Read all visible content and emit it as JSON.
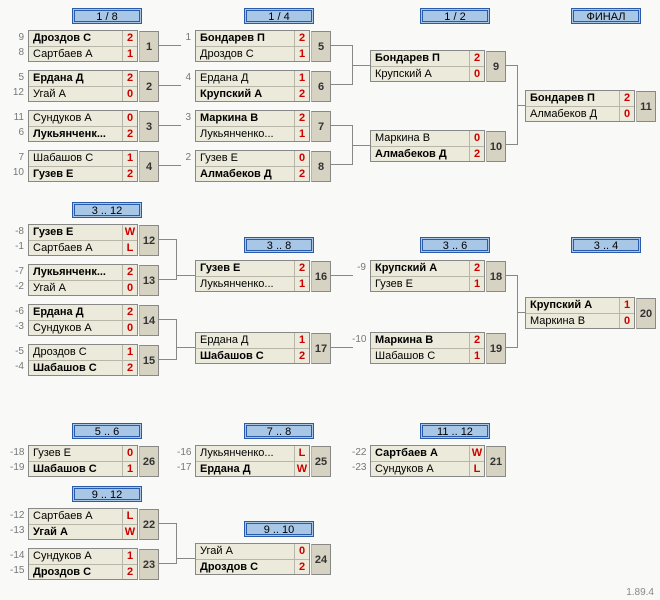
{
  "version": "1.89.4",
  "headers": {
    "r18": "1 / 8",
    "r14": "1 / 4",
    "r12": "1 / 2",
    "final": "ФИНАЛ",
    "c312": "3 .. 12",
    "c38": "3 .. 8",
    "c36": "3 .. 6",
    "c34": "3 .. 4",
    "c56": "5 .. 6",
    "c78": "7 .. 8",
    "c1112": "11 .. 12",
    "c912": "9 .. 12",
    "c910": "9 .. 10"
  },
  "m": {
    "m1": {
      "num": "1",
      "s1": "9",
      "s2": "8",
      "p1": "Дроздов С",
      "p2": "Сартбаев А",
      "v1": "2",
      "v2": "1",
      "b": 1
    },
    "m2": {
      "num": "2",
      "s1": "5",
      "s2": "12",
      "p1": "Ердана Д",
      "p2": "Угай А",
      "v1": "2",
      "v2": "0",
      "b": 1
    },
    "m3": {
      "num": "3",
      "s1": "11",
      "s2": "6",
      "p1": "Сундуков А",
      "p2": "Лукьянченк...",
      "v1": "0",
      "v2": "2",
      "b": 2
    },
    "m4": {
      "num": "4",
      "s1": "7",
      "s2": "10",
      "p1": "Шабашов С",
      "p2": "Гузев Е",
      "v1": "1",
      "v2": "2",
      "b": 2
    },
    "m5": {
      "num": "5",
      "s1": "1",
      "s2": "",
      "p1": "Бондарев П",
      "p2": "Дроздов С",
      "v1": "2",
      "v2": "1",
      "b": 1
    },
    "m6": {
      "num": "6",
      "s1": "4",
      "s2": "",
      "p1": "Ердана Д",
      "p2": "Крупский А",
      "v1": "1",
      "v2": "2",
      "b": 2
    },
    "m7": {
      "num": "7",
      "s1": "3",
      "s2": "",
      "p1": "Маркина В",
      "p2": "Лукьянченко...",
      "v1": "2",
      "v2": "1",
      "b": 1
    },
    "m8": {
      "num": "8",
      "s1": "2",
      "s2": "",
      "p1": "Гузев Е",
      "p2": "Алмабеков Д",
      "v1": "0",
      "v2": "2",
      "b": 2
    },
    "m9": {
      "num": "9",
      "s1": "",
      "s2": "",
      "p1": "Бондарев П",
      "p2": "Крупский А",
      "v1": "2",
      "v2": "0",
      "b": 1
    },
    "m10": {
      "num": "10",
      "s1": "",
      "s2": "",
      "p1": "Маркина В",
      "p2": "Алмабеков Д",
      "v1": "0",
      "v2": "2",
      "b": 2
    },
    "m11": {
      "num": "11",
      "s1": "",
      "s2": "",
      "p1": "Бондарев П",
      "p2": "Алмабеков Д",
      "v1": "2",
      "v2": "0",
      "b": 1
    },
    "m12": {
      "num": "12",
      "s1": "-8",
      "s2": "-1",
      "p1": "Гузев Е",
      "p2": "Сартбаев А",
      "v1": "W",
      "v2": "L",
      "b": 1
    },
    "m13": {
      "num": "13",
      "s1": "-7",
      "s2": "-2",
      "p1": "Лукьянченк...",
      "p2": "Угай А",
      "v1": "2",
      "v2": "0",
      "b": 1
    },
    "m14": {
      "num": "14",
      "s1": "-6",
      "s2": "-3",
      "p1": "Ердана Д",
      "p2": "Сундуков А",
      "v1": "2",
      "v2": "0",
      "b": 1
    },
    "m15": {
      "num": "15",
      "s1": "-5",
      "s2": "-4",
      "p1": "Дроздов С",
      "p2": "Шабашов С",
      "v1": "1",
      "v2": "2",
      "b": 2
    },
    "m16": {
      "num": "16",
      "s1": "",
      "s2": "",
      "p1": "Гузев Е",
      "p2": "Лукьянченко...",
      "v1": "2",
      "v2": "1",
      "b": 1
    },
    "m17": {
      "num": "17",
      "s1": "",
      "s2": "",
      "p1": "Ердана Д",
      "p2": "Шабашов С",
      "v1": "1",
      "v2": "2",
      "b": 2
    },
    "m18": {
      "num": "18",
      "s1": "-9",
      "s2": "",
      "p1": "Крупский А",
      "p2": "Гузев Е",
      "v1": "2",
      "v2": "1",
      "b": 1
    },
    "m19": {
      "num": "19",
      "s1": "-10",
      "s2": "",
      "p1": "Маркина В",
      "p2": "Шабашов С",
      "v1": "2",
      "v2": "1",
      "b": 1
    },
    "m20": {
      "num": "20",
      "s1": "",
      "s2": "",
      "p1": "Крупский А",
      "p2": "Маркина В",
      "v1": "1",
      "v2": "0",
      "b": 1
    },
    "m21": {
      "num": "21",
      "s1": "-22",
      "s2": "-23",
      "p1": "Сартбаев А",
      "p2": "Сундуков А",
      "v1": "W",
      "v2": "L",
      "b": 1
    },
    "m22": {
      "num": "22",
      "s1": "-12",
      "s2": "-13",
      "p1": "Сартбаев А",
      "p2": "Угай А",
      "v1": "L",
      "v2": "W",
      "b": 2
    },
    "m23": {
      "num": "23",
      "s1": "-14",
      "s2": "-15",
      "p1": "Сундуков А",
      "p2": "Дроздов С",
      "v1": "1",
      "v2": "2",
      "b": 2
    },
    "m24": {
      "num": "24",
      "s1": "",
      "s2": "",
      "p1": "Угай А",
      "p2": "Дроздов С",
      "v1": "0",
      "v2": "2",
      "b": 2
    },
    "m25": {
      "num": "25",
      "s1": "-16",
      "s2": "-17",
      "p1": "Лукьянченко...",
      "p2": "Ердана Д",
      "v1": "L",
      "v2": "W",
      "b": 2
    },
    "m26": {
      "num": "26",
      "s1": "-18",
      "s2": "-19",
      "p1": "Гузев Е",
      "p2": "Шабашов С",
      "v1": "0",
      "v2": "1",
      "b": 2
    }
  }
}
